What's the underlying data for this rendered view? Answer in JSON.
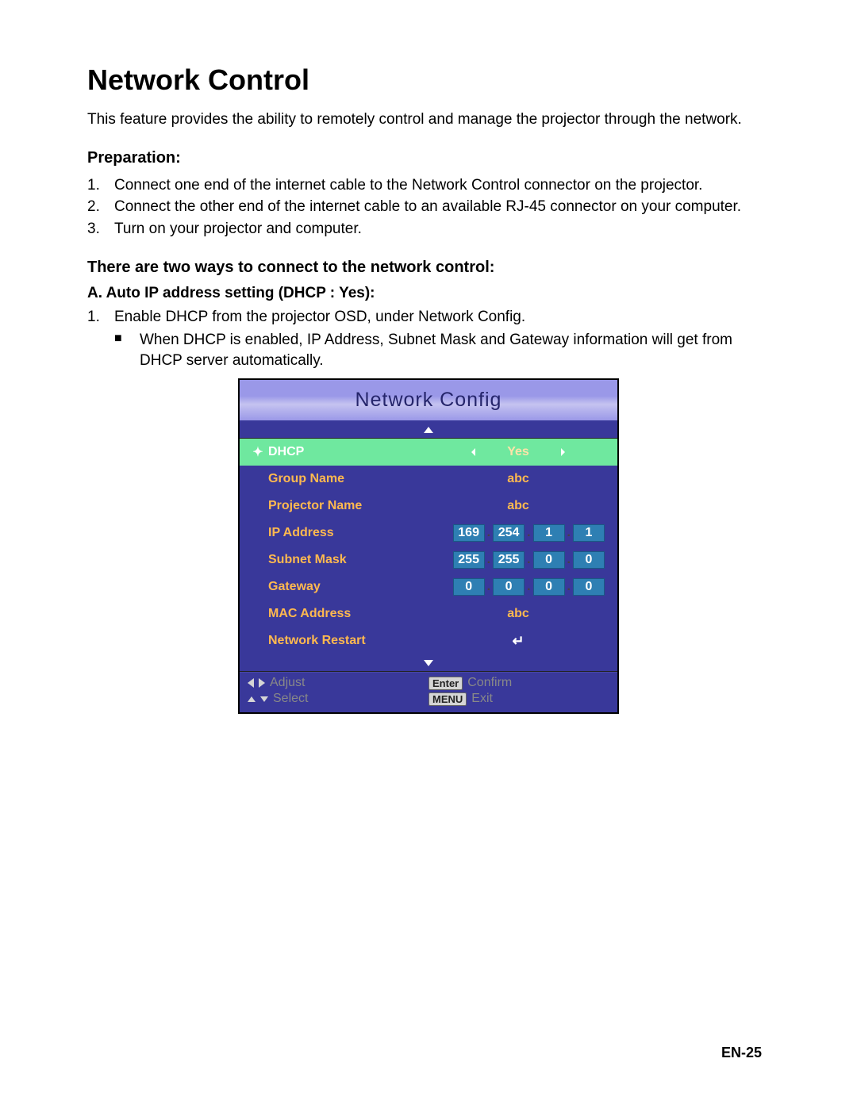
{
  "title": "Network Control",
  "intro": "This feature provides the ability to remotely control and manage the projector through the network.",
  "prep_heading": "Preparation:",
  "prep_steps": [
    "Connect one end of the internet cable to the Network Control connector on the projector.",
    "Connect the other end of the internet cable to an available RJ-45 connector on your computer.",
    "Turn on your projector and computer."
  ],
  "ways_heading": "There are two ways to connect to the network control:",
  "way_a_heading": "A. Auto IP address setting (DHCP : Yes):",
  "way_a_step": "Enable DHCP from the projector OSD, under Network Config.",
  "way_a_bullet": "When DHCP is enabled, IP Address, Subnet Mask and Gateway information will get from DHCP server automatically.",
  "osd": {
    "title": "Network Config",
    "rows": {
      "dhcp": {
        "label": "DHCP",
        "value": "Yes"
      },
      "group_name": {
        "label": "Group Name",
        "value": "abc"
      },
      "projector_name": {
        "label": "Projector Name",
        "value": "abc"
      },
      "ip_address": {
        "label": "IP Address",
        "octets": [
          "169",
          "254",
          "1",
          "1"
        ]
      },
      "subnet_mask": {
        "label": "Subnet Mask",
        "octets": [
          "255",
          "255",
          "0",
          "0"
        ]
      },
      "gateway": {
        "label": "Gateway",
        "octets": [
          "0",
          "0",
          "0",
          "0"
        ]
      },
      "mac_address": {
        "label": "MAC Address",
        "value": "abc"
      },
      "network_restart": {
        "label": "Network Restart"
      }
    },
    "footer": {
      "adjust": "Adjust",
      "select": "Select",
      "confirm": "Confirm",
      "exit": "Exit",
      "enter_key": "Enter",
      "menu_key": "MENU"
    }
  },
  "page_number": "EN-25"
}
